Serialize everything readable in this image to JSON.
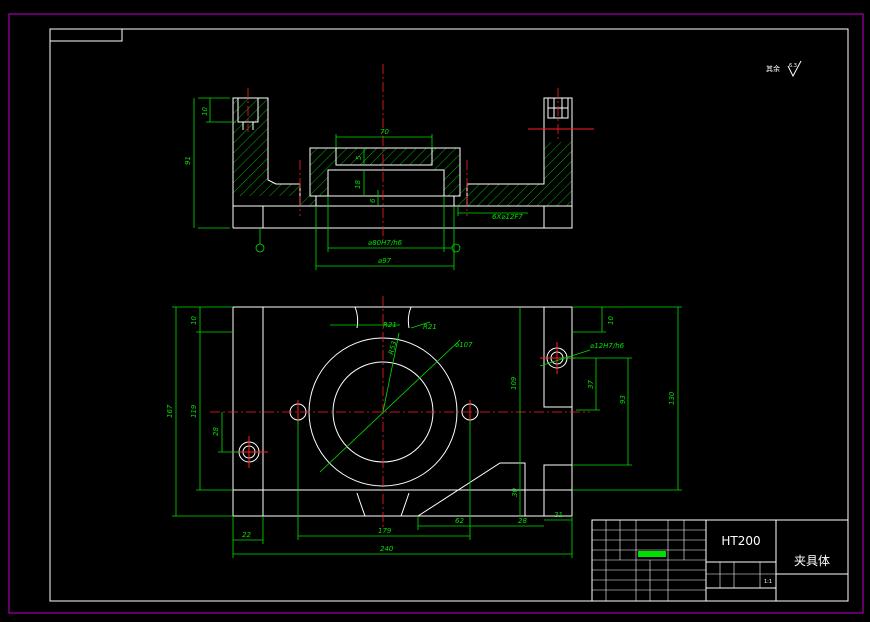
{
  "drawing": {
    "title_block": {
      "material": "HT200",
      "part_name": "夹具体",
      "scale": "1:1",
      "roughness_label": "其余"
    },
    "dimensions": {
      "front_view": {
        "top_slot_depth": "10",
        "left_height": "91",
        "bore_width": "70",
        "step_1": "5",
        "step_2": "18",
        "step_3": "6",
        "bolt_holes": "6X⌀12F7",
        "fit_bore": "⌀80H7/h6",
        "outer_diameter": "⌀97"
      },
      "top_view": {
        "radius_small": "R21",
        "radius_small_2": "R21",
        "radius_mid": "R53",
        "diameter_ring": "⌀107",
        "pin_fit": "⌀12H7/h6",
        "height_total": "167",
        "left_offset": "10",
        "left_mid": "119",
        "left_low": "28",
        "right_top": "10",
        "right_mid": "37",
        "right_big": "93",
        "right_total": "130",
        "center_vertical": "109",
        "bottom_gap": "30",
        "width_22": "22",
        "width_179": "179",
        "width_62": "62",
        "width_28": "28",
        "width_21": "21",
        "width_total": "240"
      }
    }
  }
}
